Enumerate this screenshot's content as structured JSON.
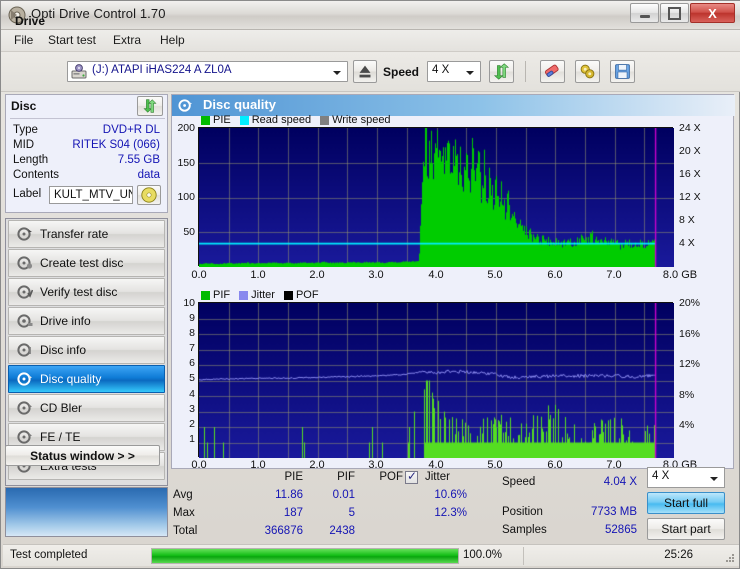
{
  "window": {
    "title": "Opti Drive Control 1.70",
    "icon": "disc-icon",
    "minimize_label": "",
    "maximize_label": "",
    "close_label": "X"
  },
  "menu": {
    "items": [
      {
        "label": "File"
      },
      {
        "label": "Start test"
      },
      {
        "label": "Extra"
      },
      {
        "label": "Help"
      }
    ]
  },
  "toolbar": {
    "drive_label": "Drive",
    "drive_value": "(J:)   ATAPI iHAS224   A ZL0A",
    "drive_icon": "drive-icon",
    "eject_icon": "eject-icon",
    "speed_label": "Speed",
    "speed_value": "4 X",
    "refresh_icon": "refresh-icon",
    "erase_icon": "erase-icon",
    "config_icon": "config-icon",
    "save_icon": "save-icon"
  },
  "disc": {
    "header": "Disc",
    "refresh_icon": "refresh-icon",
    "rows": [
      {
        "key": "Type",
        "value": "DVD+R DL"
      },
      {
        "key": "MID",
        "value": "RITEK S04 (066)"
      },
      {
        "key": "Length",
        "value": "7.55 GB"
      },
      {
        "key": "Contents",
        "value": "data"
      }
    ],
    "label_key": "Label",
    "label_value": "KULT_MTV_UN",
    "label_icon": "cd-icon"
  },
  "nav": {
    "items": [
      {
        "label": "Transfer rate",
        "icon": "disc-transfer-icon",
        "selected": false
      },
      {
        "label": "Create test disc",
        "icon": "disc-create-icon",
        "selected": false
      },
      {
        "label": "Verify test disc",
        "icon": "disc-verify-icon",
        "selected": false
      },
      {
        "label": "Drive info",
        "icon": "drive-info-icon",
        "selected": false
      },
      {
        "label": "Disc info",
        "icon": "disc-info-icon",
        "selected": false
      },
      {
        "label": "Disc quality",
        "icon": "disc-quality-icon",
        "selected": true
      },
      {
        "label": "CD Bler",
        "icon": "disc-bler-icon",
        "selected": false
      },
      {
        "label": "FE / TE",
        "icon": "disc-fete-icon",
        "selected": false
      },
      {
        "label": "Extra tests",
        "icon": "disc-extra-icon",
        "selected": false
      }
    ]
  },
  "status_window_button": "Status window > >",
  "panel": {
    "header": "Disc quality",
    "header_icon": "disc-quality-icon"
  },
  "stats": {
    "col_pie": "PIE",
    "col_pif": "PIF",
    "col_pof": "POF",
    "col_jitter": "Jitter",
    "jitter_checked": true,
    "row_avg": "Avg",
    "row_max": "Max",
    "row_total": "Total",
    "pie_avg": "11.86",
    "pie_max": "187",
    "pie_total": "366876",
    "pif_avg": "0.01",
    "pif_max": "5",
    "pif_total": "2438",
    "pof_avg": "",
    "pof_max": "",
    "pof_total": "",
    "jitter_avg": "10.6%",
    "jitter_max": "12.3%",
    "speed_label": "Speed",
    "speed_value": "4.04 X",
    "position_label": "Position",
    "position_value": "7733 MB",
    "samples_label": "Samples",
    "samples_value": "52865",
    "speed_select": "4 X",
    "start_full": "Start full",
    "start_part": "Start part"
  },
  "statusbar": {
    "text": "Test completed",
    "percent": "100.0%",
    "progress": 100,
    "time": "25:26"
  },
  "colors": {
    "pie": "#00cc00",
    "read_speed": "#00eeff",
    "write_speed": "#808080",
    "pif": "#00cc00",
    "jitter": "#8888ee",
    "pof": "#000000",
    "plot_bg_top": "#000060",
    "plot_bg_bottom": "#1a1a9c",
    "marker": "#cc00cc",
    "value_text": "#1414b4",
    "accent": "#0e7bd6"
  },
  "chart_data": [
    {
      "type": "area",
      "title": "",
      "legend": [
        {
          "label": "PIE",
          "color": "#00cc00"
        },
        {
          "label": "Read speed",
          "color": "#00eeff"
        },
        {
          "label": "Write speed",
          "color": "#808080"
        }
      ],
      "legend_position": "top-left",
      "xlabel": "GB",
      "ylabel": "",
      "xlim": [
        0.0,
        8.0
      ],
      "ylim": [
        0,
        200
      ],
      "y2lim": [
        0,
        24
      ],
      "xticks": [
        "0.0",
        "1.0",
        "2.0",
        "3.0",
        "4.0",
        "5.0",
        "6.0",
        "7.0",
        "8.0 GB"
      ],
      "yticks": [
        "50",
        "100",
        "150",
        "200"
      ],
      "y2ticks": [
        "4 X",
        "8 X",
        "12 X",
        "16 X",
        "20 X",
        "24 X"
      ],
      "grid": true,
      "marker_x": 7.69,
      "series": [
        {
          "name": "PIE",
          "color": "#00cc00",
          "x": [
            0.0,
            0.1,
            0.2,
            0.3,
            0.4,
            0.5,
            0.6,
            0.7,
            0.8,
            0.9,
            1.0,
            1.1,
            1.2,
            1.3,
            1.4,
            1.5,
            1.6,
            1.7,
            1.8,
            1.9,
            2.0,
            2.1,
            2.2,
            2.3,
            2.4,
            2.5,
            2.6,
            2.7,
            2.8,
            2.9,
            3.0,
            3.1,
            3.2,
            3.3,
            3.4,
            3.5,
            3.6,
            3.7,
            3.75,
            3.8,
            3.85,
            3.9,
            3.95,
            4.0,
            4.05,
            4.1,
            4.15,
            4.2,
            4.25,
            4.3,
            4.35,
            4.4,
            4.45,
            4.5,
            4.55,
            4.6,
            4.65,
            4.7,
            4.75,
            4.8,
            4.85,
            4.9,
            4.95,
            5.0,
            5.05,
            5.1,
            5.15,
            5.2,
            5.25,
            5.3,
            5.35,
            5.4,
            5.5,
            5.6,
            5.7,
            5.8,
            5.9,
            6.0,
            6.1,
            6.2,
            6.3,
            6.4,
            6.5,
            6.6,
            6.7,
            6.8,
            6.9,
            7.0,
            7.1,
            7.2,
            7.3,
            7.4,
            7.5,
            7.6,
            7.69
          ],
          "values": [
            4,
            5,
            5,
            4,
            5,
            6,
            5,
            5,
            6,
            5,
            6,
            5,
            6,
            6,
            5,
            6,
            5,
            6,
            6,
            6,
            6,
            7,
            6,
            6,
            6,
            6,
            7,
            6,
            7,
            6,
            7,
            6,
            7,
            7,
            7,
            8,
            8,
            9,
            120,
            176,
            150,
            168,
            140,
            185,
            158,
            172,
            150,
            162,
            140,
            168,
            128,
            152,
            120,
            144,
            110,
            160,
            105,
            150,
            96,
            140,
            92,
            128,
            85,
            120,
            78,
            110,
            70,
            96,
            62,
            88,
            56,
            76,
            48,
            44,
            40,
            38,
            36,
            34,
            33,
            36,
            32,
            40,
            33,
            45,
            34,
            38,
            32,
            36,
            30,
            34,
            31,
            35,
            30,
            33,
            32
          ]
        },
        {
          "name": "Read speed",
          "color": "#00eeff",
          "x": [
            0.0,
            1.0,
            2.0,
            3.0,
            4.0,
            5.0,
            6.0,
            7.0,
            7.69
          ],
          "values": [
            4.04,
            4.04,
            4.04,
            4.04,
            4.04,
            4.04,
            4.04,
            4.04,
            4.04
          ],
          "axis": "y2"
        }
      ]
    },
    {
      "type": "area",
      "title": "",
      "legend": [
        {
          "label": "PIF",
          "color": "#00cc00"
        },
        {
          "label": "Jitter",
          "color": "#8888ee"
        },
        {
          "label": "POF",
          "color": "#000000"
        }
      ],
      "legend_position": "top-left",
      "xlabel": "GB",
      "ylabel": "",
      "xlim": [
        0.0,
        8.0
      ],
      "ylim": [
        0,
        10
      ],
      "y2lim": [
        0,
        20
      ],
      "xticks": [
        "0.0",
        "1.0",
        "2.0",
        "3.0",
        "4.0",
        "5.0",
        "6.0",
        "7.0",
        "8.0 GB"
      ],
      "yticks": [
        "1",
        "2",
        "3",
        "4",
        "5",
        "6",
        "7",
        "8",
        "9",
        "10"
      ],
      "y2ticks": [
        "4%",
        "8%",
        "12%",
        "16%",
        "20%"
      ],
      "grid": true,
      "marker_x": 7.69,
      "series": [
        {
          "name": "PIF",
          "color": "#55dd22",
          "description": "sparse spikes of 1-3, dense band of 1 after 3.8 GB",
          "x": [
            0.05,
            0.6,
            1.25,
            1.35,
            1.45,
            1.6,
            1.75,
            1.95,
            2.1,
            2.3,
            2.45,
            2.6,
            2.9,
            3.05,
            3.2,
            3.4,
            3.6,
            3.7,
            3.78,
            3.85,
            3.95,
            4.05,
            4.2,
            4.35,
            4.5,
            4.65,
            4.8,
            4.95,
            5.1,
            5.3,
            5.5,
            5.7,
            5.9,
            6.1,
            6.3,
            6.5,
            6.7,
            6.9,
            7.1,
            7.3,
            7.5,
            7.65
          ],
          "values": [
            1,
            2,
            2,
            1,
            1,
            2,
            1,
            1,
            2,
            1,
            2,
            1,
            1,
            2,
            1,
            1,
            3,
            3,
            3,
            5,
            3,
            3,
            2,
            2,
            2,
            1,
            2,
            2,
            2,
            2,
            2,
            2,
            3,
            2,
            2,
            1,
            2,
            2,
            2,
            1,
            2,
            2
          ]
        },
        {
          "name": "Jitter",
          "color": "#8888ee",
          "axis": "y2",
          "x": [
            0.0,
            0.5,
            1.0,
            1.5,
            2.0,
            2.5,
            3.0,
            3.5,
            3.8,
            4.0,
            4.2,
            4.5,
            4.8,
            5.0,
            5.2,
            5.4,
            5.6,
            5.8,
            6.0,
            6.3,
            6.6,
            7.0,
            7.3,
            7.6,
            7.69
          ],
          "values": [
            10.1,
            10.2,
            10.3,
            10.3,
            10.4,
            10.5,
            10.6,
            10.8,
            11.2,
            11.0,
            11.2,
            11.1,
            11.0,
            10.8,
            10.5,
            10.4,
            10.5,
            10.5,
            10.6,
            10.6,
            10.6,
            10.6,
            10.5,
            10.6,
            10.6
          ]
        }
      ]
    }
  ]
}
